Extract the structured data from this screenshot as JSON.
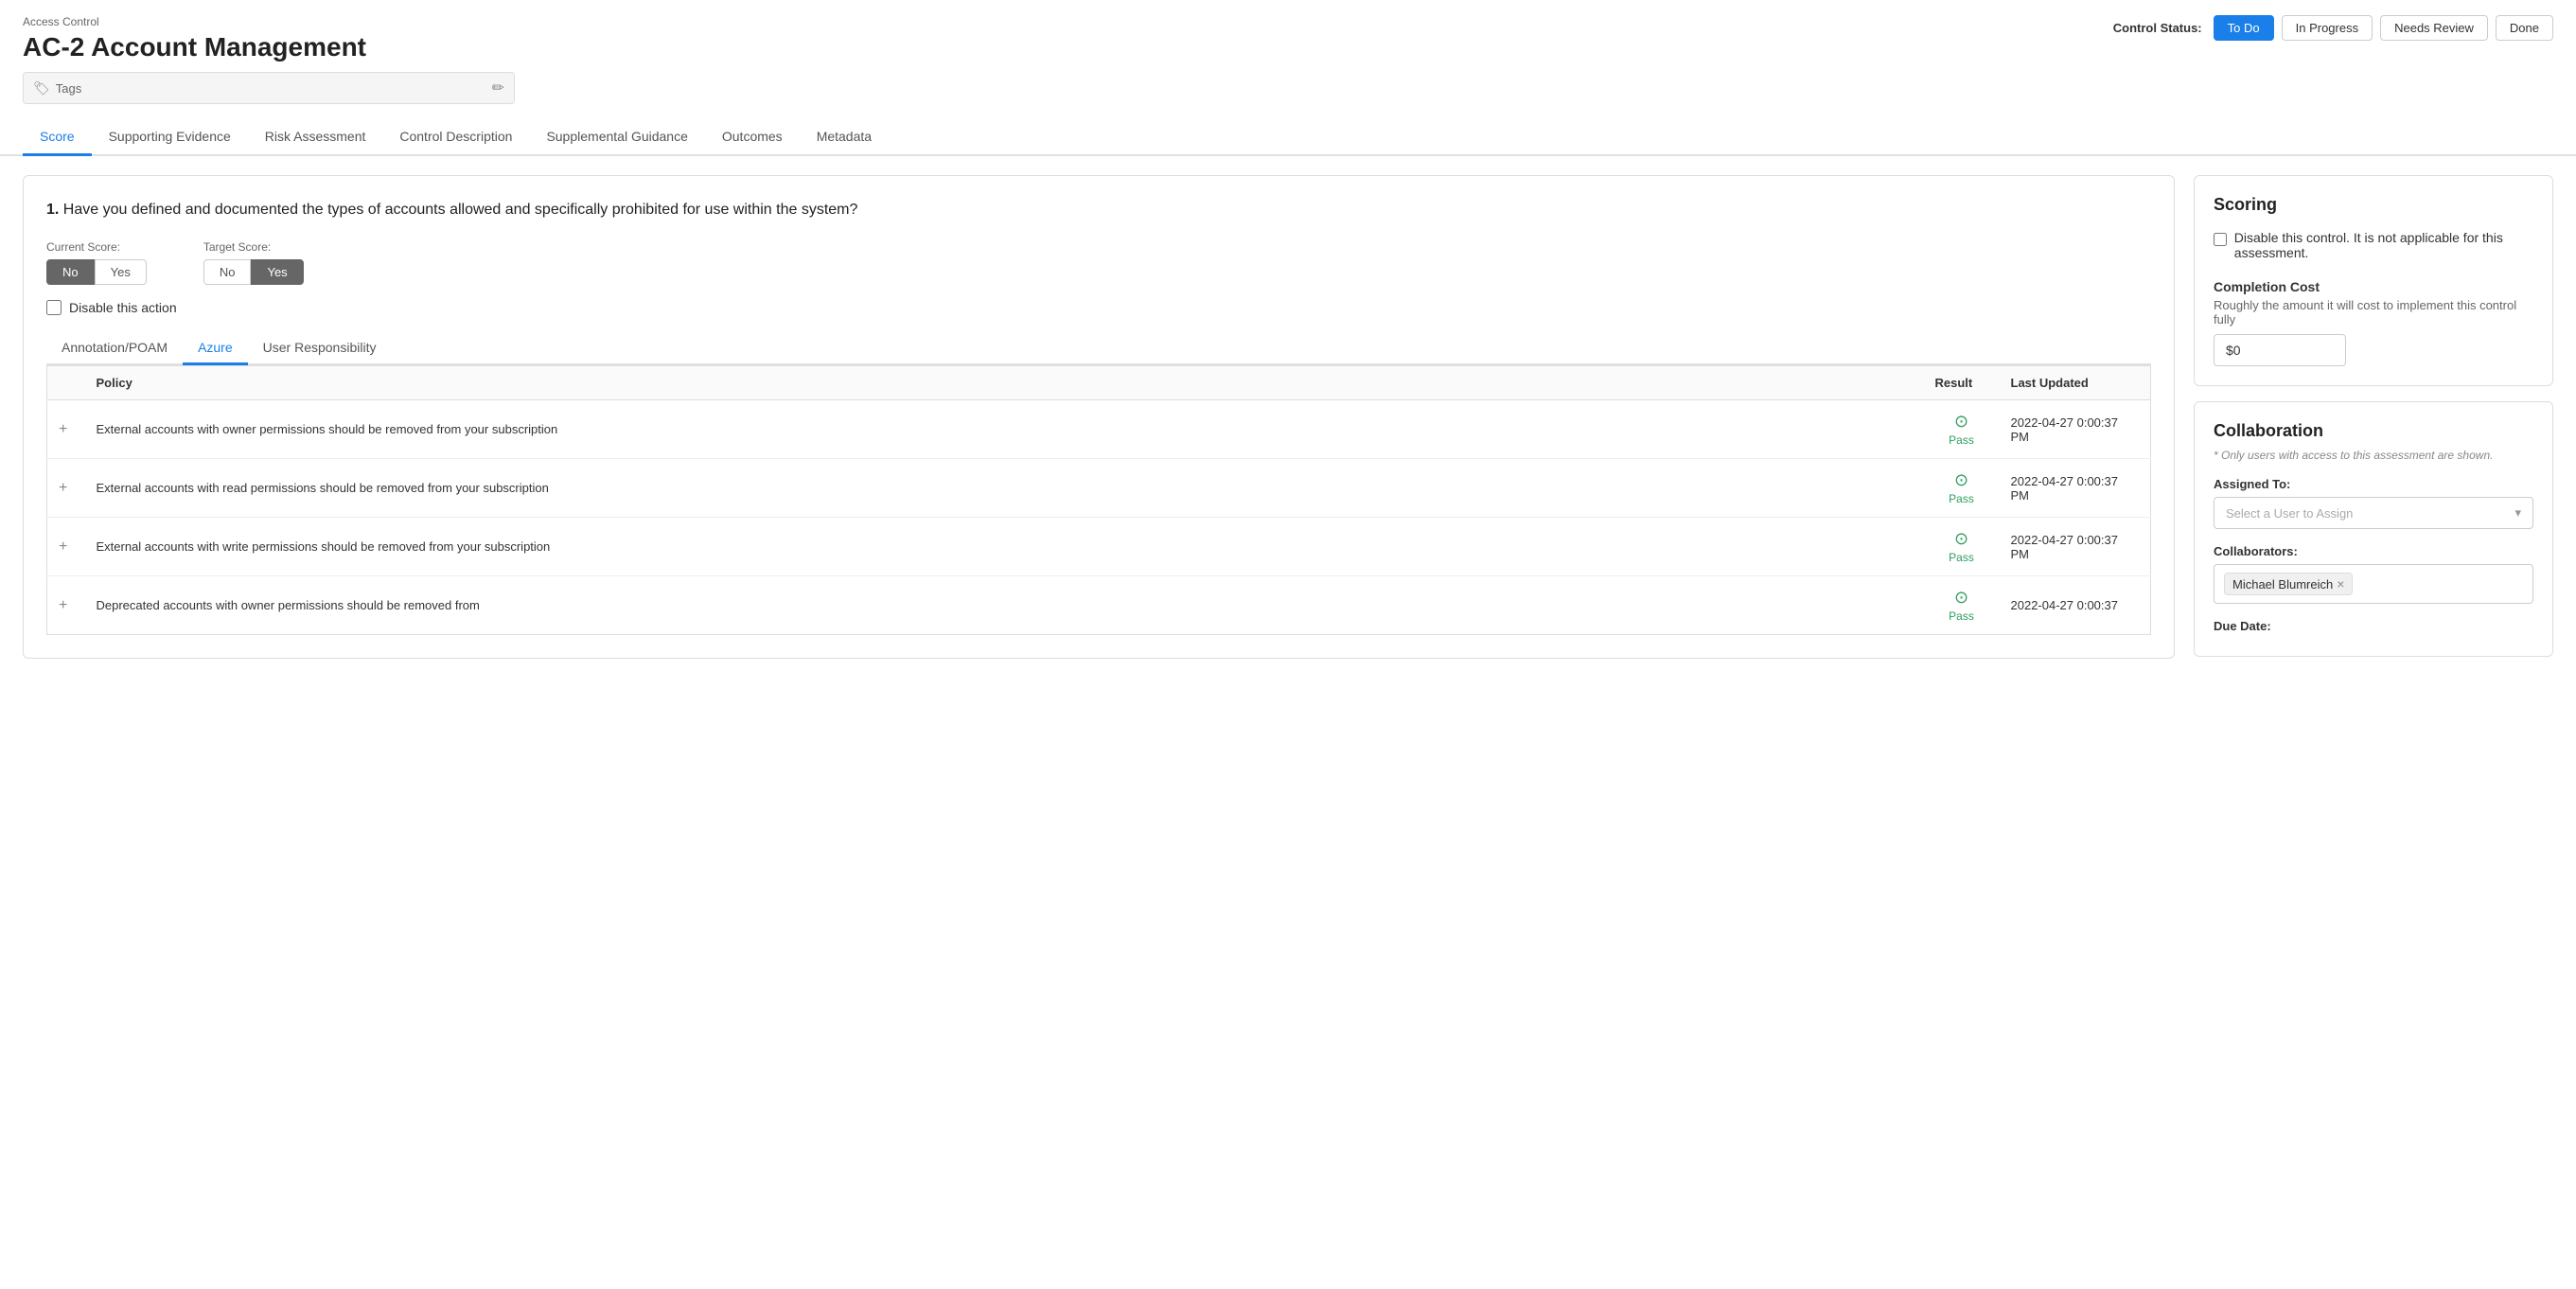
{
  "header": {
    "breadcrumb": "Access Control",
    "title": "AC-2 Account Management",
    "tags_placeholder": "Tags",
    "tags_edit_icon": "✏",
    "control_status_label": "Control Status:",
    "status_buttons": [
      {
        "id": "todo",
        "label": "To Do",
        "active": true
      },
      {
        "id": "in-progress",
        "label": "In Progress",
        "active": false
      },
      {
        "id": "needs-review",
        "label": "Needs Review",
        "active": false
      },
      {
        "id": "done",
        "label": "Done",
        "active": false
      }
    ]
  },
  "tabs": [
    {
      "id": "score",
      "label": "Score",
      "active": true
    },
    {
      "id": "supporting-evidence",
      "label": "Supporting Evidence",
      "active": false
    },
    {
      "id": "risk-assessment",
      "label": "Risk Assessment",
      "active": false
    },
    {
      "id": "control-description",
      "label": "Control Description",
      "active": false
    },
    {
      "id": "supplemental-guidance",
      "label": "Supplemental Guidance",
      "active": false
    },
    {
      "id": "outcomes",
      "label": "Outcomes",
      "active": false
    },
    {
      "id": "metadata",
      "label": "Metadata",
      "active": false
    }
  ],
  "question": {
    "number": "1.",
    "text": "Have you defined and documented the types of accounts allowed and specifically prohibited for use within the system?",
    "current_score_label": "Current Score:",
    "current_score_no": "No",
    "current_score_yes": "Yes",
    "current_selected": "No",
    "target_score_label": "Target Score:",
    "target_score_no": "No",
    "target_score_yes": "Yes",
    "target_selected": "Yes",
    "disable_action_label": "Disable this action"
  },
  "sub_tabs": [
    {
      "id": "annotation",
      "label": "Annotation/POAM",
      "active": false
    },
    {
      "id": "azure",
      "label": "Azure",
      "active": true
    },
    {
      "id": "user-responsibility",
      "label": "User Responsibility",
      "active": false
    }
  ],
  "policy_table": {
    "columns": [
      {
        "id": "expand",
        "label": ""
      },
      {
        "id": "policy",
        "label": "Policy"
      },
      {
        "id": "result",
        "label": "Result"
      },
      {
        "id": "last-updated",
        "label": "Last Updated"
      }
    ],
    "rows": [
      {
        "expand": "+",
        "policy": "External accounts with owner permissions should be removed from your subscription",
        "result": "Pass",
        "pass_icon": "✓",
        "last_updated": "2022-04-27 0:00:37 PM"
      },
      {
        "expand": "+",
        "policy": "External accounts with read permissions should be removed from your subscription",
        "result": "Pass",
        "pass_icon": "✓",
        "last_updated": "2022-04-27 0:00:37 PM"
      },
      {
        "expand": "+",
        "policy": "External accounts with write permissions should be removed from your subscription",
        "result": "Pass",
        "pass_icon": "✓",
        "last_updated": "2022-04-27 0:00:37 PM"
      },
      {
        "expand": "+",
        "policy": "Deprecated accounts with owner permissions should be removed from",
        "result": "Pass",
        "pass_icon": "✓",
        "last_updated": "2022-04-27 0:00:37"
      }
    ]
  },
  "scoring": {
    "title": "Scoring",
    "disable_control_label": "Disable this control. It is not applicable for this assessment.",
    "completion_cost_title": "Completion Cost",
    "completion_cost_desc": "Roughly the amount it will cost to implement this control fully",
    "cost_value": "$0"
  },
  "collaboration": {
    "title": "Collaboration",
    "note": "* Only users with access to this assessment are shown.",
    "assigned_to_label": "Assigned To:",
    "assign_placeholder": "Select a User to Assign",
    "collaborators_label": "Collaborators:",
    "collaborators": [
      {
        "name": "Michael Blumreich",
        "remove": "×"
      }
    ],
    "due_date_label": "Due Date:"
  }
}
